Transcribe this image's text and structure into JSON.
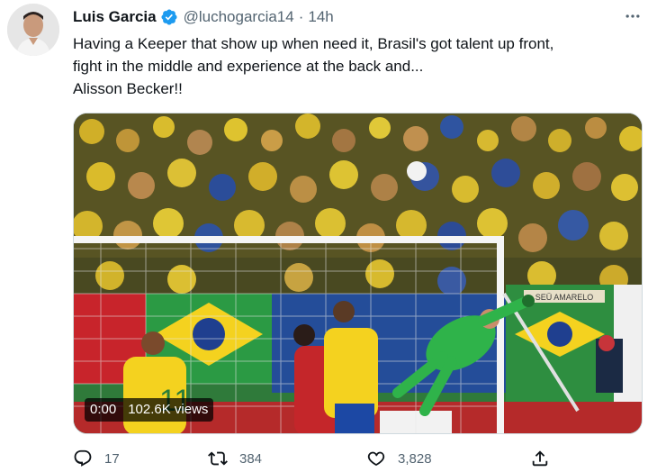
{
  "author": {
    "name": "Luis Garcia",
    "handle": "@luchogarcia14",
    "time": "14h",
    "verified": true
  },
  "tweet": {
    "lines": [
      "Having a Keeper that show up when need it, Brasil's got talent up front,",
      "fight in the middle and experience at the back and...",
      "Alisson Becker!!"
    ]
  },
  "media": {
    "timestamp": "0:00",
    "views": "102.6K views",
    "signboard_text": "SEÜ AMARELO"
  },
  "actions": {
    "replies": "17",
    "retweets": "384",
    "likes": "3,828"
  },
  "icons": {
    "more": "more-horizontal-icon",
    "reply": "reply-icon",
    "retweet": "retweet-icon",
    "like": "heart-icon",
    "share": "share-icon",
    "verified": "verified-badge-icon"
  },
  "colors": {
    "text_primary": "#0f1419",
    "text_secondary": "#536471",
    "verified_blue": "#1d9bf0",
    "keeper_green": "#2fb34a",
    "brazil_yellow": "#f4d21f"
  }
}
